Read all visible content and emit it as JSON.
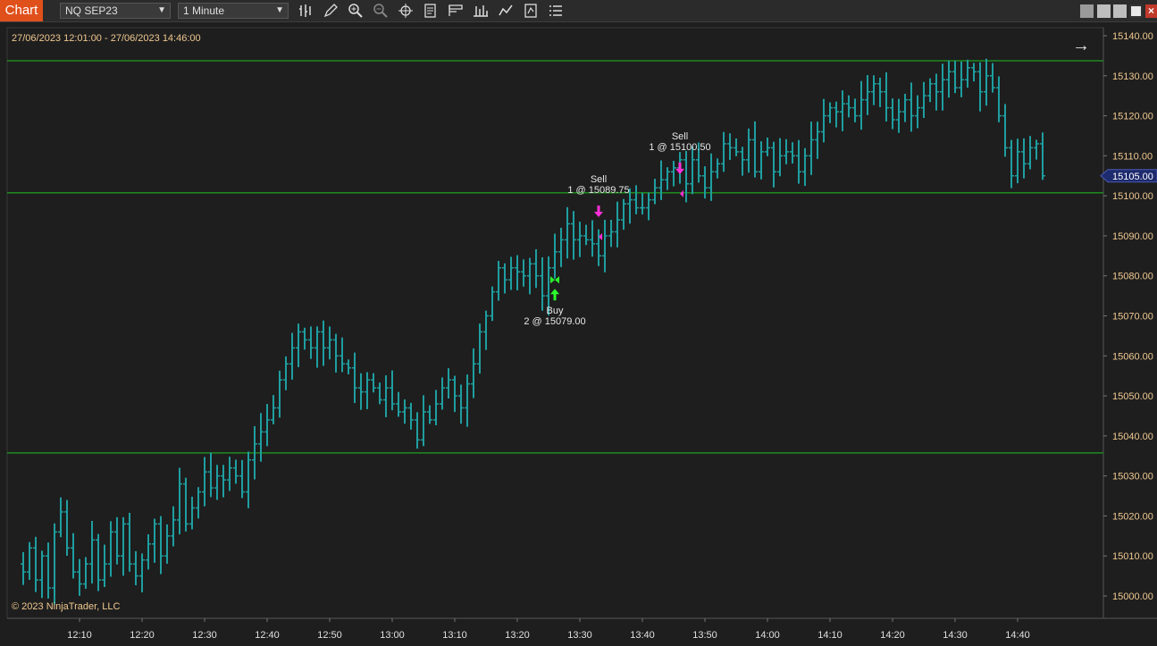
{
  "toolbar": {
    "tab_label": "Chart",
    "instrument": "NQ SEP23",
    "interval": "1 Minute"
  },
  "chart_data": {
    "type": "ohlc",
    "date_range": "27/06/2023 12:01:00 - 27/06/2023 14:46:00",
    "copyright": "© 2023 NinjaTrader, LLC",
    "y_ticks": [
      "15140.00",
      "15130.00",
      "15120.00",
      "15110.00",
      "15100.00",
      "15090.00",
      "15080.00",
      "15070.00",
      "15060.00",
      "15050.00",
      "15040.00",
      "15030.00",
      "15020.00",
      "15010.00",
      "15000.00"
    ],
    "ylim": [
      14997,
      15141
    ],
    "x_ticks": [
      "12:10",
      "12:20",
      "12:30",
      "12:40",
      "12:50",
      "13:00",
      "13:10",
      "13:20",
      "13:30",
      "13:40",
      "13:50",
      "14:00",
      "14:10",
      "14:20",
      "14:30",
      "14:40"
    ],
    "last_price": "15105.00",
    "colors": {
      "bar": "#1f9ea0",
      "hline": "#1f8a1f",
      "sell": "#ff2fd9",
      "buy": "#2aff2a",
      "axis_text": "#f0c890",
      "last_price_bg": "#1e2a6e"
    },
    "horizontal_lines": [
      15133.75,
      15100.75,
      15035.75
    ],
    "closes": [
      15006,
      15012,
      15004,
      15010,
      15002,
      15016,
      15021,
      15012,
      15006,
      15003,
      15008,
      15014,
      15004,
      15008,
      15016,
      15010,
      15018,
      15008,
      15005,
      15009,
      15013,
      15018,
      15010,
      15015,
      15019,
      15028,
      15018,
      15022,
      15026,
      15031,
      15027,
      15030,
      15029,
      15032,
      15030,
      15026,
      15034,
      15038,
      15041,
      15044,
      15047,
      15054,
      15058,
      15062,
      15066,
      15064,
      15062,
      15066,
      15062,
      15064,
      15060,
      15058,
      15057,
      15052,
      15051,
      15054,
      15052,
      15049,
      15052,
      15048,
      15046,
      15047,
      15044,
      15039,
      15046,
      15044,
      15048,
      15052,
      15054,
      15050,
      15047,
      15053,
      15058,
      15066,
      15070,
      15076,
      15082,
      15079,
      15082,
      15081,
      15080,
      15083,
      15080,
      15075,
      15082,
      15086,
      15089,
      15093,
      15089,
      15090,
      15089,
      15088,
      15085,
      15090,
      15091,
      15094,
      15098,
      15099,
      15097,
      15097,
      15099,
      15102,
      15104,
      15106,
      15107,
      15109,
      15103,
      15109,
      15105,
      15102,
      15106,
      15108,
      15113,
      15112,
      15111,
      15109,
      15114,
      15106,
      15111,
      15112,
      15106,
      15110,
      15111,
      15110,
      15106,
      15110,
      15114,
      15116,
      15120,
      15122,
      15121,
      15123,
      15122,
      15120,
      15124,
      15126,
      15128,
      15126,
      15122,
      15119,
      15121,
      15124,
      15120,
      15122,
      15125,
      15128,
      15126,
      15129,
      15131,
      15127,
      15129,
      15132,
      15131,
      15126,
      15130,
      15127,
      15120,
      15112,
      15105,
      15111,
      15108,
      15112,
      15113,
      15105
    ],
    "trades": [
      {
        "side": "Buy",
        "label": "Buy",
        "detail": "2 @ 15079.00",
        "price": 15079.0,
        "time": "13:26"
      },
      {
        "side": "Sell",
        "label": "Sell",
        "detail": "1 @ 15089.75",
        "price": 15089.75,
        "time": "13:33"
      },
      {
        "side": "Sell",
        "label": "Sell",
        "detail": "1 @ 15100.50",
        "price": 15100.5,
        "time": "13:46"
      }
    ]
  }
}
